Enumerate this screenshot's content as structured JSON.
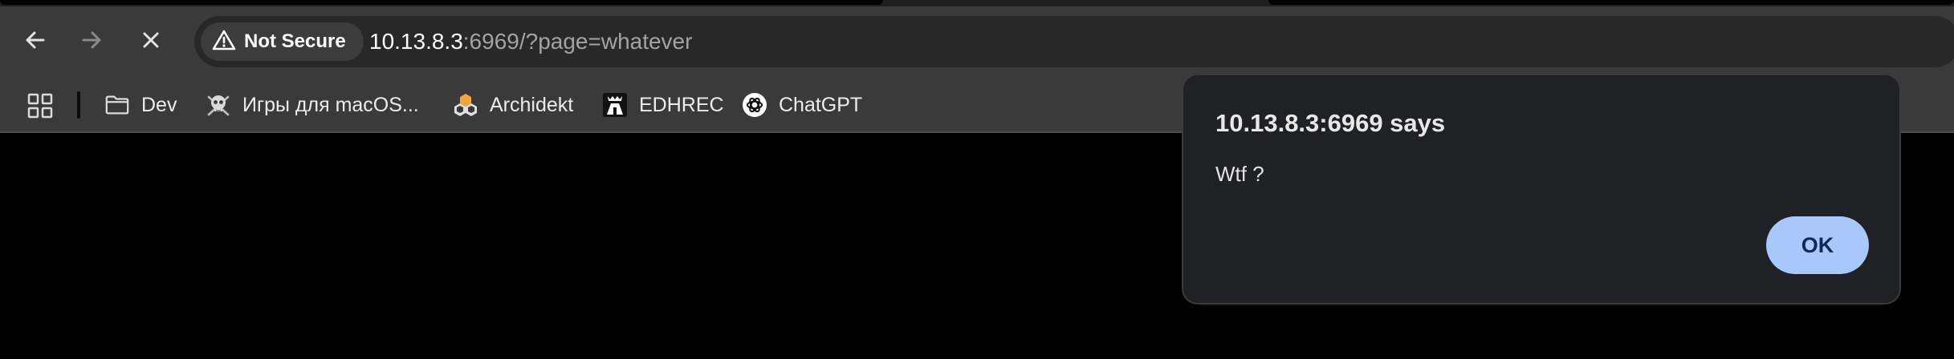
{
  "toolbar": {
    "back_icon": "arrow-left-icon",
    "forward_icon": "arrow-right-icon",
    "stop_icon": "close-icon"
  },
  "omnibox": {
    "security_label": "Not Secure",
    "security_icon": "warning-icon",
    "url_host": "10.13.8.3",
    "url_rest": ":6969/?page=whatever"
  },
  "bookmarks": {
    "apps_icon": "apps-grid-icon",
    "items": [
      {
        "label": "Dev",
        "icon": "folder-icon"
      },
      {
        "label": "Игры для macOS...",
        "icon": "skull-icon"
      },
      {
        "label": "Archidekt",
        "icon": "archidekt-logo-icon"
      },
      {
        "label": "EDHREC",
        "icon": "edhrec-logo-icon"
      },
      {
        "label": "ChatGPT",
        "icon": "chatgpt-logo-icon"
      }
    ]
  },
  "dialog": {
    "title": "10.13.8.3:6969 says",
    "message": "Wtf ?",
    "ok_label": "OK"
  },
  "colors": {
    "toolbar_bg": "#3a3a3a",
    "omnibox_bg": "#282828",
    "dialog_bg": "#202124",
    "ok_button_bg": "#a8c7fa",
    "page_bg": "#000000"
  }
}
